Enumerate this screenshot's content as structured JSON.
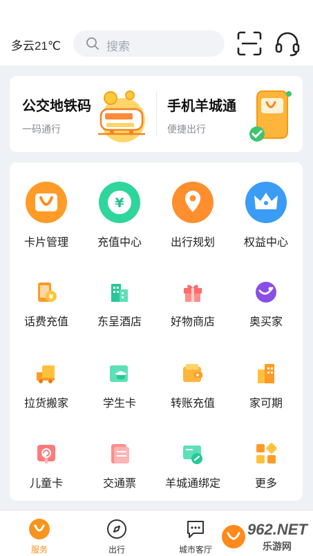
{
  "header": {
    "weather": "多云21℃",
    "search_placeholder": "搜索"
  },
  "transit": {
    "left": {
      "title": "公交地铁码",
      "subtitle": "一码通行"
    },
    "right": {
      "title": "手机羊城通",
      "subtitle": "便捷出行"
    }
  },
  "services": [
    {
      "label": "卡片管理",
      "icon": "card-manage-icon"
    },
    {
      "label": "充值中心",
      "icon": "recharge-icon"
    },
    {
      "label": "出行规划",
      "icon": "trip-plan-icon"
    },
    {
      "label": "权益中心",
      "icon": "crown-icon"
    },
    {
      "label": "话费充值",
      "icon": "phone-bill-icon"
    },
    {
      "label": "东呈酒店",
      "icon": "hotel-icon"
    },
    {
      "label": "好物商店",
      "icon": "gift-icon"
    },
    {
      "label": "奥买家",
      "icon": "aomaijia-icon"
    },
    {
      "label": "拉货搬家",
      "icon": "truck-icon"
    },
    {
      "label": "学生卡",
      "icon": "student-card-icon"
    },
    {
      "label": "转账充值",
      "icon": "wallet-icon"
    },
    {
      "label": "家可期",
      "icon": "building-icon"
    },
    {
      "label": "儿童卡",
      "icon": "kids-card-icon"
    },
    {
      "label": "交通票",
      "icon": "ticket-icon"
    },
    {
      "label": "羊城通绑定",
      "icon": "bind-link-icon"
    },
    {
      "label": "更多",
      "icon": "more-grid-icon"
    }
  ],
  "nav": [
    {
      "label": "服务",
      "active": true
    },
    {
      "label": "出行",
      "active": false
    },
    {
      "label": "城市客厅",
      "active": false
    }
  ],
  "watermark": {
    "text": "962.NET",
    "subtext": "乐游网"
  },
  "colors": {
    "accent": "#f7941d",
    "primary_text": "#222222",
    "muted_text": "#8a8d94"
  }
}
